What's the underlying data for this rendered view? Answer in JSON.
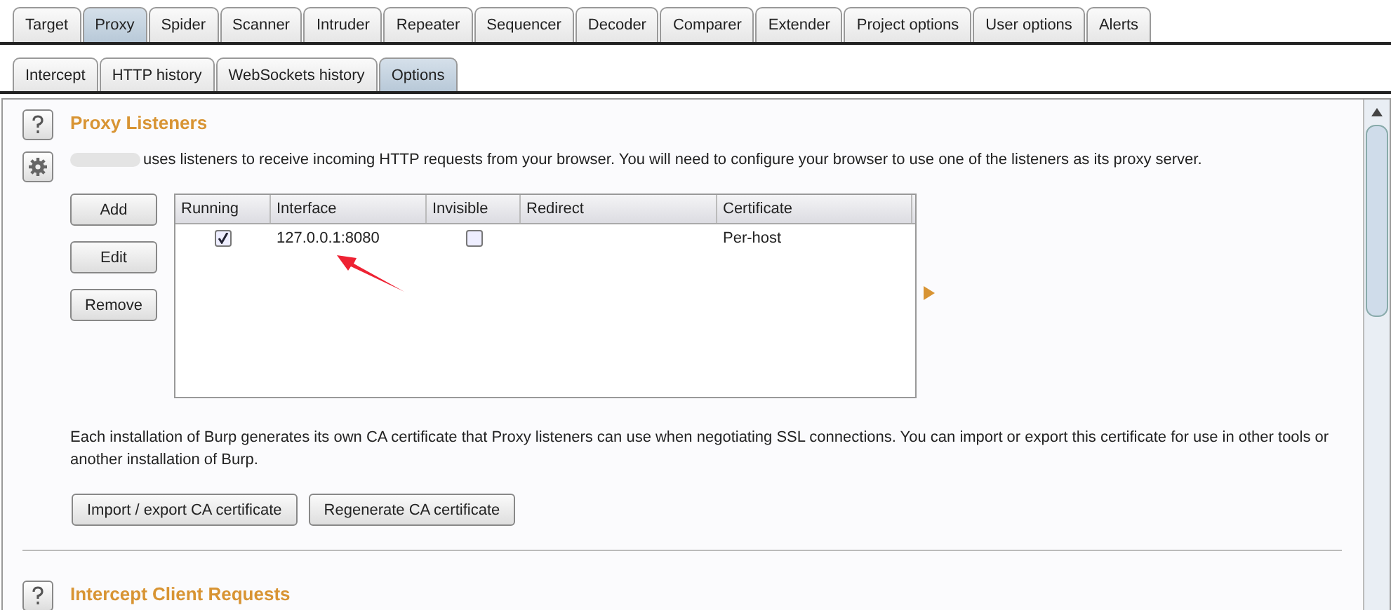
{
  "main_tabs": [
    {
      "label": "Target",
      "selected": false
    },
    {
      "label": "Proxy",
      "selected": true
    },
    {
      "label": "Spider",
      "selected": false
    },
    {
      "label": "Scanner",
      "selected": false
    },
    {
      "label": "Intruder",
      "selected": false
    },
    {
      "label": "Repeater",
      "selected": false
    },
    {
      "label": "Sequencer",
      "selected": false
    },
    {
      "label": "Decoder",
      "selected": false
    },
    {
      "label": "Comparer",
      "selected": false
    },
    {
      "label": "Extender",
      "selected": false
    },
    {
      "label": "Project options",
      "selected": false
    },
    {
      "label": "User options",
      "selected": false
    },
    {
      "label": "Alerts",
      "selected": false
    }
  ],
  "sub_tabs": [
    {
      "label": "Intercept",
      "selected": false
    },
    {
      "label": "HTTP history",
      "selected": false
    },
    {
      "label": "WebSockets history",
      "selected": false
    },
    {
      "label": "Options",
      "selected": true
    }
  ],
  "listeners": {
    "title": "Proxy Listeners",
    "description": "uses listeners to receive incoming HTTP requests from your browser. You will need to configure your browser to use one of the listeners as its proxy server.",
    "side_buttons": [
      "Add",
      "Edit",
      "Remove"
    ],
    "table": {
      "columns": [
        "Running",
        "Interface",
        "Invisible",
        "Redirect",
        "Certificate"
      ],
      "rows": [
        {
          "running": true,
          "interface": "127.0.0.1:8080",
          "invisible": false,
          "certificate": "Per-host"
        }
      ]
    },
    "note": "Each installation of Burp generates its own CA certificate that Proxy listeners can use when negotiating SSL connections. You can import or export this certificate for use in other tools or another installation of Burp.",
    "buttons": [
      "Import / export CA certificate",
      "Regenerate CA certificate"
    ]
  },
  "intercept_client_requests": {
    "title": "Intercept Client Requests"
  }
}
